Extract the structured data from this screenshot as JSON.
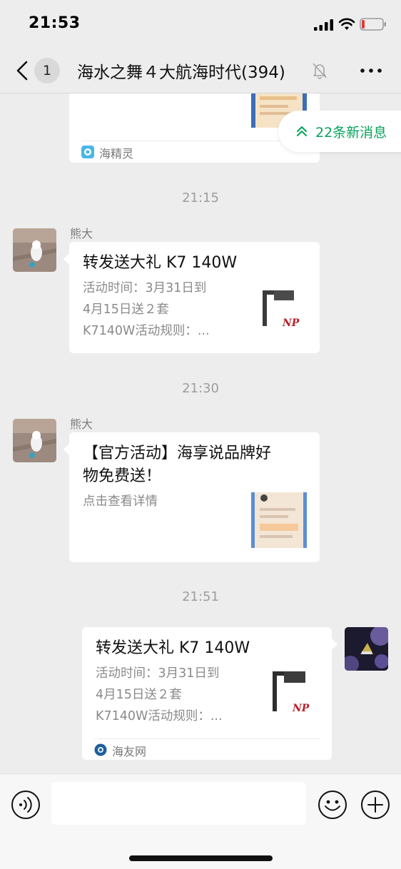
{
  "status_bar": {
    "time": "21:53",
    "battery_level": 0.1,
    "battery_color": "#e53935"
  },
  "nav": {
    "unread_count": "1",
    "title": "海水之舞４大航海时代(394)"
  },
  "new_messages": {
    "label": "22条新消息",
    "color": "#07a35a"
  },
  "messages": [
    {
      "type": "card-partial",
      "source": "海精灵"
    },
    {
      "type": "timestamp",
      "text": "21:15"
    },
    {
      "type": "card",
      "sender": "熊大",
      "title": "转发送大礼 K7 140W",
      "desc_lines": [
        "活动时间：3月31日到",
        "4月15日送２套",
        "K7140W活动规则：..."
      ]
    },
    {
      "type": "timestamp",
      "text": "21:30"
    },
    {
      "type": "card",
      "sender": "熊大",
      "title_lines": [
        "【官方活动】海享说品牌好",
        "物免费送！"
      ],
      "desc": "点击查看详情"
    },
    {
      "type": "timestamp",
      "text": "21:51"
    },
    {
      "type": "card-self",
      "title": "转发送大礼 K7 140W",
      "desc_lines": [
        "活动时间：3月31日到",
        "4月15日送２套",
        "K7140W活动规则：..."
      ],
      "source": "海友网"
    }
  ],
  "thumb_brand": "NP",
  "input": {
    "placeholder": "",
    "value": ""
  },
  "colors": {
    "background": "#ededed",
    "accent_green": "#07a35a",
    "bubble": "#ffffff",
    "brand_red": "#b3202a"
  }
}
